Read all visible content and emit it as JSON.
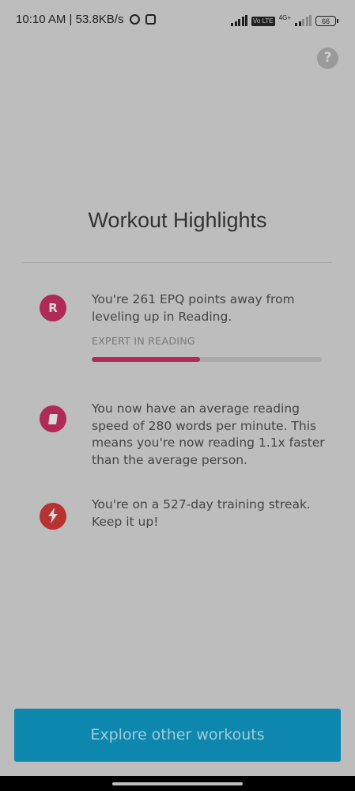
{
  "status_bar": {
    "time_speed": "10:10 AM | 53.8KB/s",
    "volte": "Vo LTE",
    "network": "4G+",
    "battery": "66"
  },
  "help": {
    "label": "?"
  },
  "title": "Workout Highlights",
  "highlights": [
    {
      "icon": "reading-r-icon",
      "icon_letter": "R",
      "icon_color": "#b02a57",
      "text": "You're 261 EPQ points away from leveling up in Reading.",
      "level_label": "EXPERT IN READING",
      "progress_percent": 47
    },
    {
      "icon": "book-icon",
      "icon_color": "#b02a57",
      "text": "You now have an average reading speed of 280 words per minute. This means you're now reading 1.1x faster than the average person."
    },
    {
      "icon": "lightning-icon",
      "icon_color": "#b83232",
      "text": "You're on a 527-day training streak. Keep it up!"
    }
  ],
  "cta": {
    "label": "Explore other workouts",
    "color": "#0d87ad"
  }
}
